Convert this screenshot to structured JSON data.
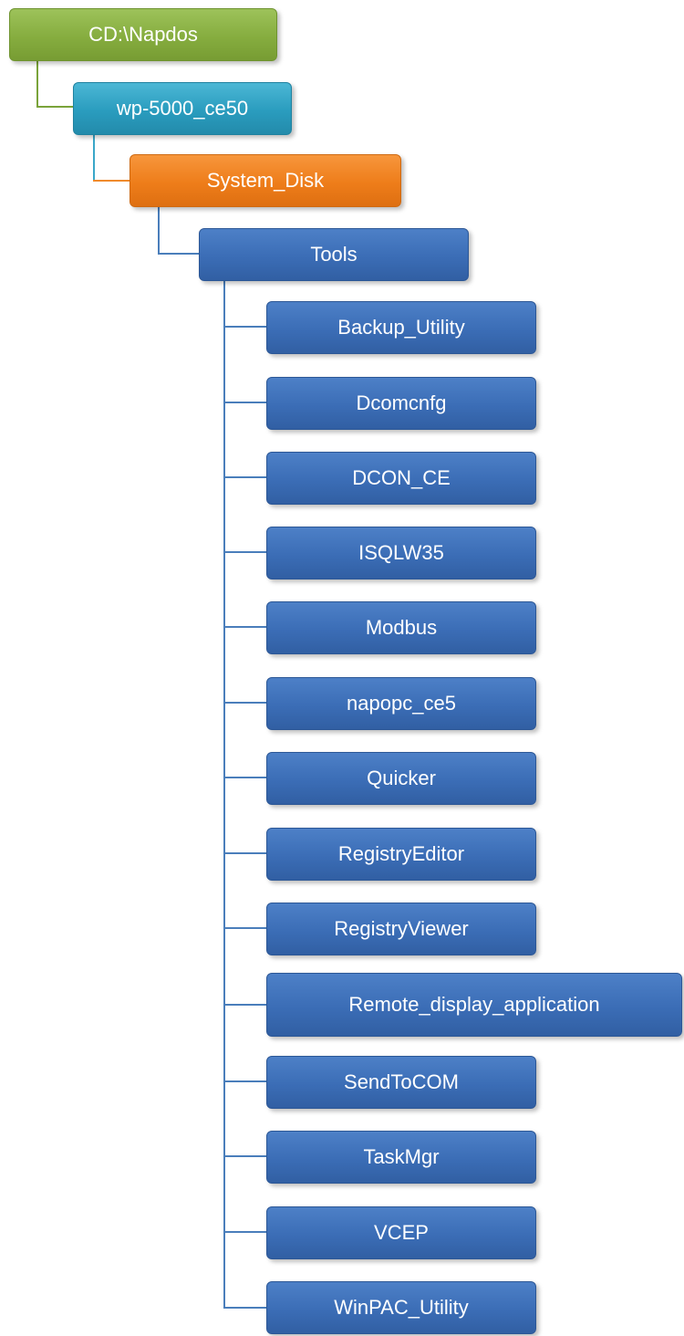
{
  "tree": {
    "root": {
      "label": "CD:\\Napdos",
      "color": "#86ad3f"
    },
    "level1": {
      "label": "wp-5000_ce50",
      "color": "#2a9cbe"
    },
    "level2": {
      "label": "System_Disk",
      "color": "#ee7d1a"
    },
    "level3": {
      "label": "Tools",
      "color": "#3b6db6"
    },
    "tools": [
      {
        "label": "Backup_Utility"
      },
      {
        "label": "Dcomcnfg"
      },
      {
        "label": "DCON_CE"
      },
      {
        "label": "ISQLW35"
      },
      {
        "label": "Modbus"
      },
      {
        "label": "napopc_ce5"
      },
      {
        "label": "Quicker"
      },
      {
        "label": "RegistryEditor"
      },
      {
        "label": "RegistryViewer"
      },
      {
        "label": "Remote_display_application"
      },
      {
        "label": "SendToCOM"
      },
      {
        "label": "TaskMgr"
      },
      {
        "label": "VCEP"
      },
      {
        "label": "WinPAC_Utility"
      }
    ]
  }
}
